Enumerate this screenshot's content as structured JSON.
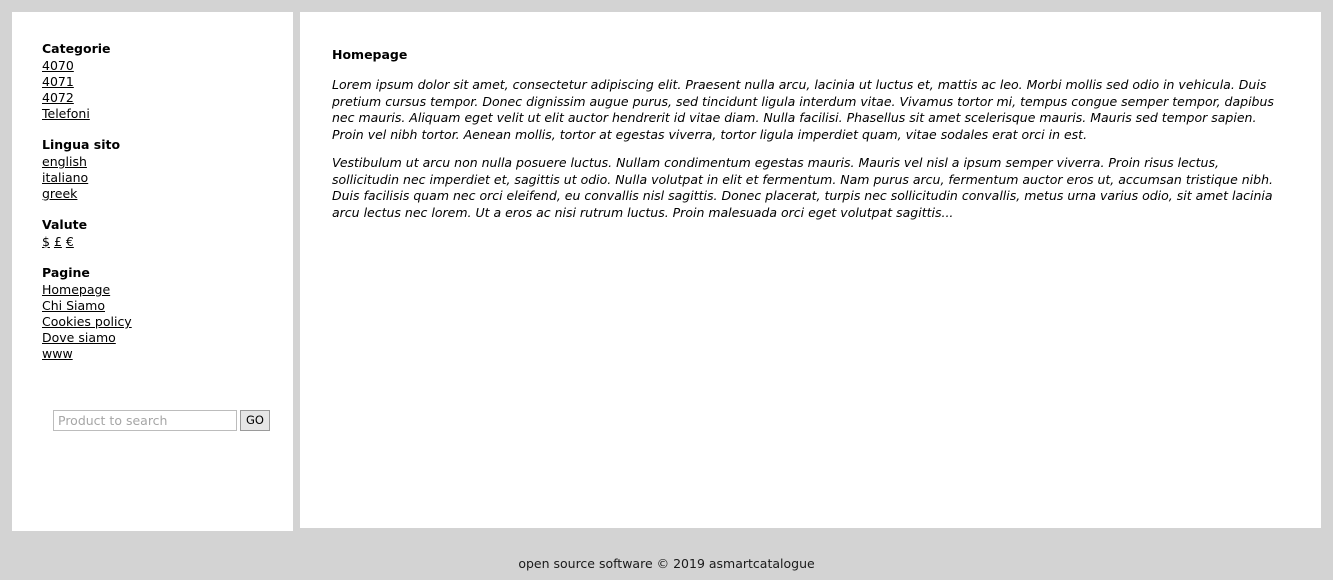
{
  "sidebar": {
    "blocks": [
      {
        "heading": "Categorie",
        "links": [
          "4070",
          "4071",
          "4072",
          "Telefoni"
        ]
      },
      {
        "heading": "Lingua sito",
        "links": [
          "english",
          "italiano",
          "greek"
        ]
      },
      {
        "heading": "Valute",
        "links": [
          "$",
          "£",
          "€"
        ],
        "inline": true
      },
      {
        "heading": "Pagine",
        "links": [
          "Homepage",
          "Chi Siamo",
          "Cookies policy",
          "Dove siamo",
          "www"
        ]
      }
    ],
    "search": {
      "value": "",
      "placeholder": "Product to search",
      "button_label": "GO"
    }
  },
  "main": {
    "title": "Homepage",
    "paragraphs": [
      "Lorem ipsum dolor sit amet, consectetur adipiscing elit. Praesent nulla arcu, lacinia ut luctus et, mattis ac leo. Morbi mollis sed odio in vehicula. Duis pretium cursus tempor. Donec dignissim augue purus, sed tincidunt ligula interdum vitae. Vivamus tortor mi, tempus congue semper tempor, dapibus nec mauris. Aliquam eget velit ut elit auctor hendrerit id vitae diam. Nulla facilisi. Phasellus sit amet scelerisque mauris. Mauris sed tempor sapien. Proin vel nibh tortor. Aenean mollis, tortor at egestas viverra, tortor ligula imperdiet quam, vitae sodales erat orci in est.",
      "Vestibulum ut arcu non nulla posuere luctus. Nullam condimentum egestas mauris. Mauris vel nisl a ipsum semper viverra. Proin risus lectus, sollicitudin nec imperdiet et, sagittis ut odio. Nulla volutpat in elit et fermentum. Nam purus arcu, fermentum auctor eros ut, accumsan tristique nibh. Duis facilisis quam nec orci eleifend, eu convallis nisl sagittis. Donec placerat, turpis nec sollicitudin convallis, metus urna varius odio, sit amet lacinia arcu lectus nec lorem. Ut a eros ac nisi rutrum luctus. Proin malesuada orci eget volutpat sagittis..."
    ]
  },
  "footer": {
    "text": "open source software © 2019 asmartcatalogue"
  },
  "colors": {
    "page_background": "#d3d3d3",
    "panel_background": "#ffffff",
    "text": "#000000",
    "placeholder": "#a6a6a6",
    "button_background": "#e6e6e6"
  }
}
